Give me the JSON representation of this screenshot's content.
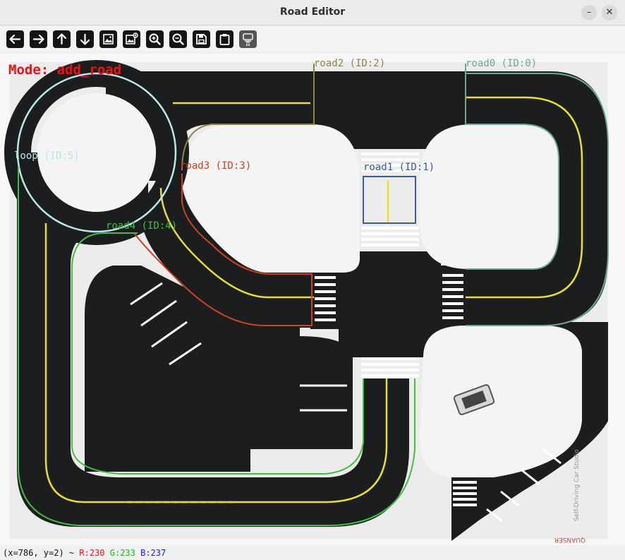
{
  "window": {
    "title": "Road Editor",
    "minimize_glyph": "–",
    "close_glyph": "✕"
  },
  "toolbar": {
    "buttons": [
      {
        "name": "pan-left",
        "icon": "arrow-left-icon"
      },
      {
        "name": "pan-right",
        "icon": "arrow-right-icon"
      },
      {
        "name": "pan-up",
        "icon": "arrow-up-icon"
      },
      {
        "name": "pan-down",
        "icon": "arrow-down-icon"
      },
      {
        "name": "zoom-image",
        "icon": "image-icon"
      },
      {
        "name": "edit-image",
        "icon": "image-edit-icon"
      },
      {
        "name": "zoom-in",
        "icon": "zoom-in-icon"
      },
      {
        "name": "zoom-out",
        "icon": "zoom-out-icon"
      },
      {
        "name": "save",
        "icon": "save-icon"
      },
      {
        "name": "clipboard",
        "icon": "clipboard-icon"
      },
      {
        "name": "settings",
        "icon": "settings-icon"
      }
    ]
  },
  "canvas": {
    "mode_label": "Mode: add_road",
    "roads": [
      {
        "label": "road2 (ID:2)",
        "color": "#8f8448"
      },
      {
        "label": "road0 (ID:0)",
        "color": "#6fa890"
      },
      {
        "label": "loop (ID:5)",
        "color": "#b8e8e8"
      },
      {
        "label": "road3 (ID:3)",
        "color": "#d04020"
      },
      {
        "label": "road1 (ID:1)",
        "color": "#3858a8"
      },
      {
        "label": "road4 (ID:4)",
        "color": "#40c040"
      }
    ],
    "map_text": "Self-Driving Car Studio",
    "brand_text": "QUANSER"
  },
  "status": {
    "coords": "(x=786, y=2) ~",
    "r": "R:230",
    "g": "G:233",
    "b": "B:237",
    "r_color": "#e01818",
    "g_color": "#18b818",
    "b_color": "#1818d8"
  }
}
